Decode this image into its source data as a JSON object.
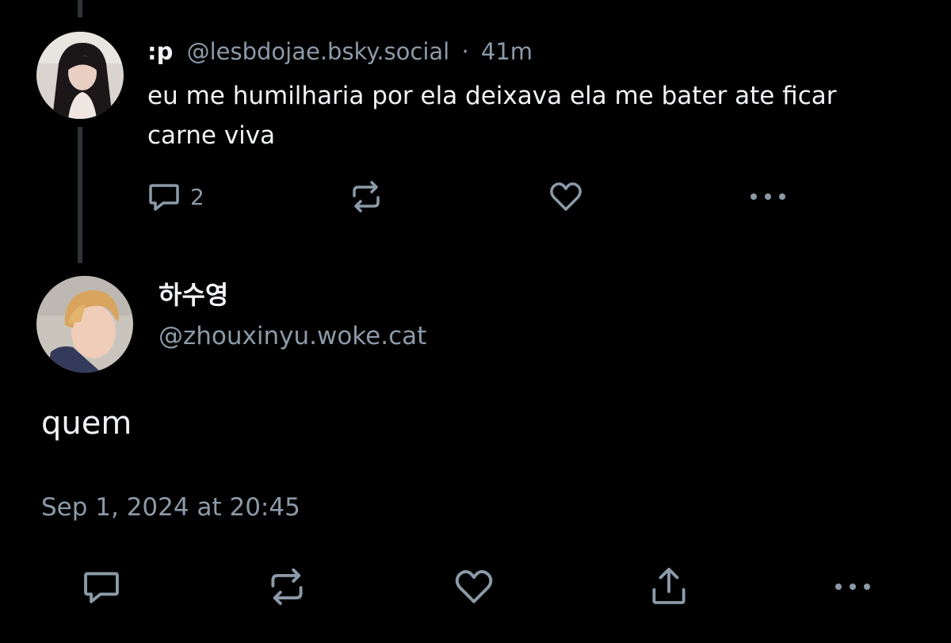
{
  "parent_post": {
    "display_name": ":p",
    "handle": "@lesbdojae.bsky.social",
    "separator": "·",
    "time_ago": "41m",
    "text": "eu me humilharia por ela deixava ela me bater ate ficar carne viva",
    "reply_count": "2",
    "icons": [
      "reply-icon",
      "repost-icon",
      "like-icon",
      "more-icon"
    ]
  },
  "main_post": {
    "display_name": "하수영",
    "handle": "@zhouxinyu.woke.cat",
    "text": "quem",
    "timestamp": "Sep 1, 2024 at 20:45",
    "icons": [
      "reply-icon",
      "repost-icon",
      "like-icon",
      "share-icon",
      "more-icon"
    ]
  },
  "colors": {
    "background": "#000000",
    "text": "#f1f3f5",
    "muted": "#8c9aa8",
    "thread_line": "#2e3438"
  }
}
